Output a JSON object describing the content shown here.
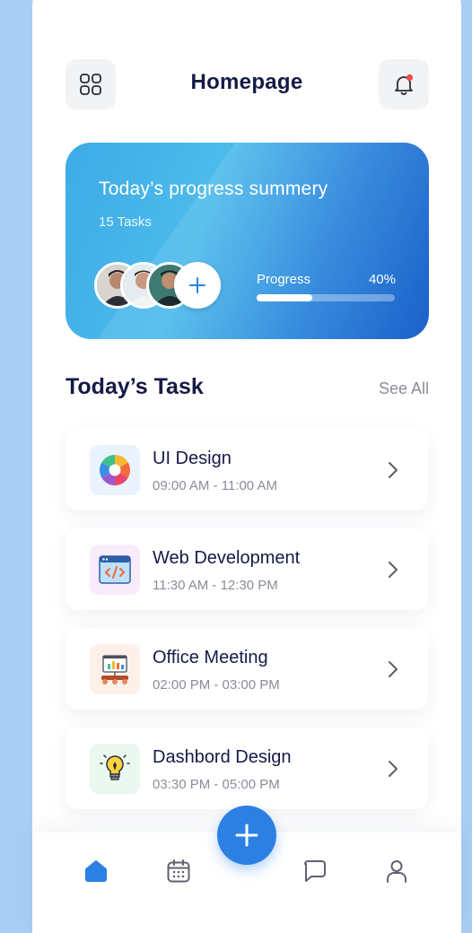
{
  "header": {
    "title": "Homepage",
    "menu_icon": "grid-icon",
    "notification_icon": "bell-icon",
    "notification_dot_color": "#f04a4a"
  },
  "summary": {
    "title": "Today’s progress summery",
    "task_count": "15 Tasks",
    "progress_label": "Progress",
    "progress_value": "40%",
    "progress_fraction": 0.4,
    "gradient_colors": [
      "#3dabe6",
      "#4dbbeb",
      "#2f86dc",
      "#1c62c9"
    ],
    "add_member_icon": "plus-icon"
  },
  "tasks_section": {
    "title": "Today’s Task",
    "see_all": "See All"
  },
  "tasks": [
    {
      "name": "UI Design",
      "time": "09:00 AM - 11:00 AM",
      "icon": "color-wheel-icon",
      "icon_bg": "#eaf3fd"
    },
    {
      "name": "Web Development",
      "time": "11:30 AM - 12:30 PM",
      "icon": "code-window-icon",
      "icon_bg": "#f8ecfb"
    },
    {
      "name": "Office Meeting",
      "time": "02:00 PM - 03:00 PM",
      "icon": "presentation-board-icon",
      "icon_bg": "#fdf0e8"
    },
    {
      "name": "Dashbord Design",
      "time": "03:30 PM - 05:00 PM",
      "icon": "lightbulb-pen-icon",
      "icon_bg": "#eaf8ef"
    }
  ],
  "bottom_nav": {
    "items": [
      "home-icon",
      "calendar-icon",
      "chat-icon",
      "profile-icon"
    ],
    "active": "home-icon",
    "active_color": "#2c80e4",
    "inactive_color": "#5f6270",
    "fab_icon": "plus-icon"
  }
}
